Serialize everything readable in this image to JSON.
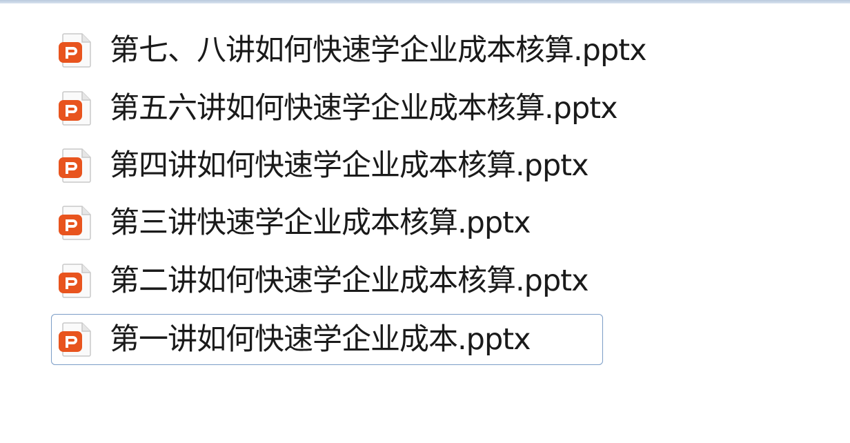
{
  "files": [
    {
      "name": "第七、八讲如何快速学企业成本核算.pptx",
      "icon": "powerpoint-icon",
      "selected": false
    },
    {
      "name": "第五六讲如何快速学企业成本核算.pptx",
      "icon": "powerpoint-icon",
      "selected": false
    },
    {
      "name": "第四讲如何快速学企业成本核算.pptx",
      "icon": "powerpoint-icon",
      "selected": false
    },
    {
      "name": "第三讲快速学企业成本核算.pptx",
      "icon": "powerpoint-icon",
      "selected": false
    },
    {
      "name": "第二讲如何快速学企业成本核算.pptx",
      "icon": "powerpoint-icon",
      "selected": false
    },
    {
      "name": "第一讲如何快速学企业成本.pptx",
      "icon": "powerpoint-icon",
      "selected": true
    }
  ],
  "colors": {
    "icon_orange": "#e8541e",
    "icon_page": "#fafafa",
    "selection_border": "#7a9cc6"
  }
}
